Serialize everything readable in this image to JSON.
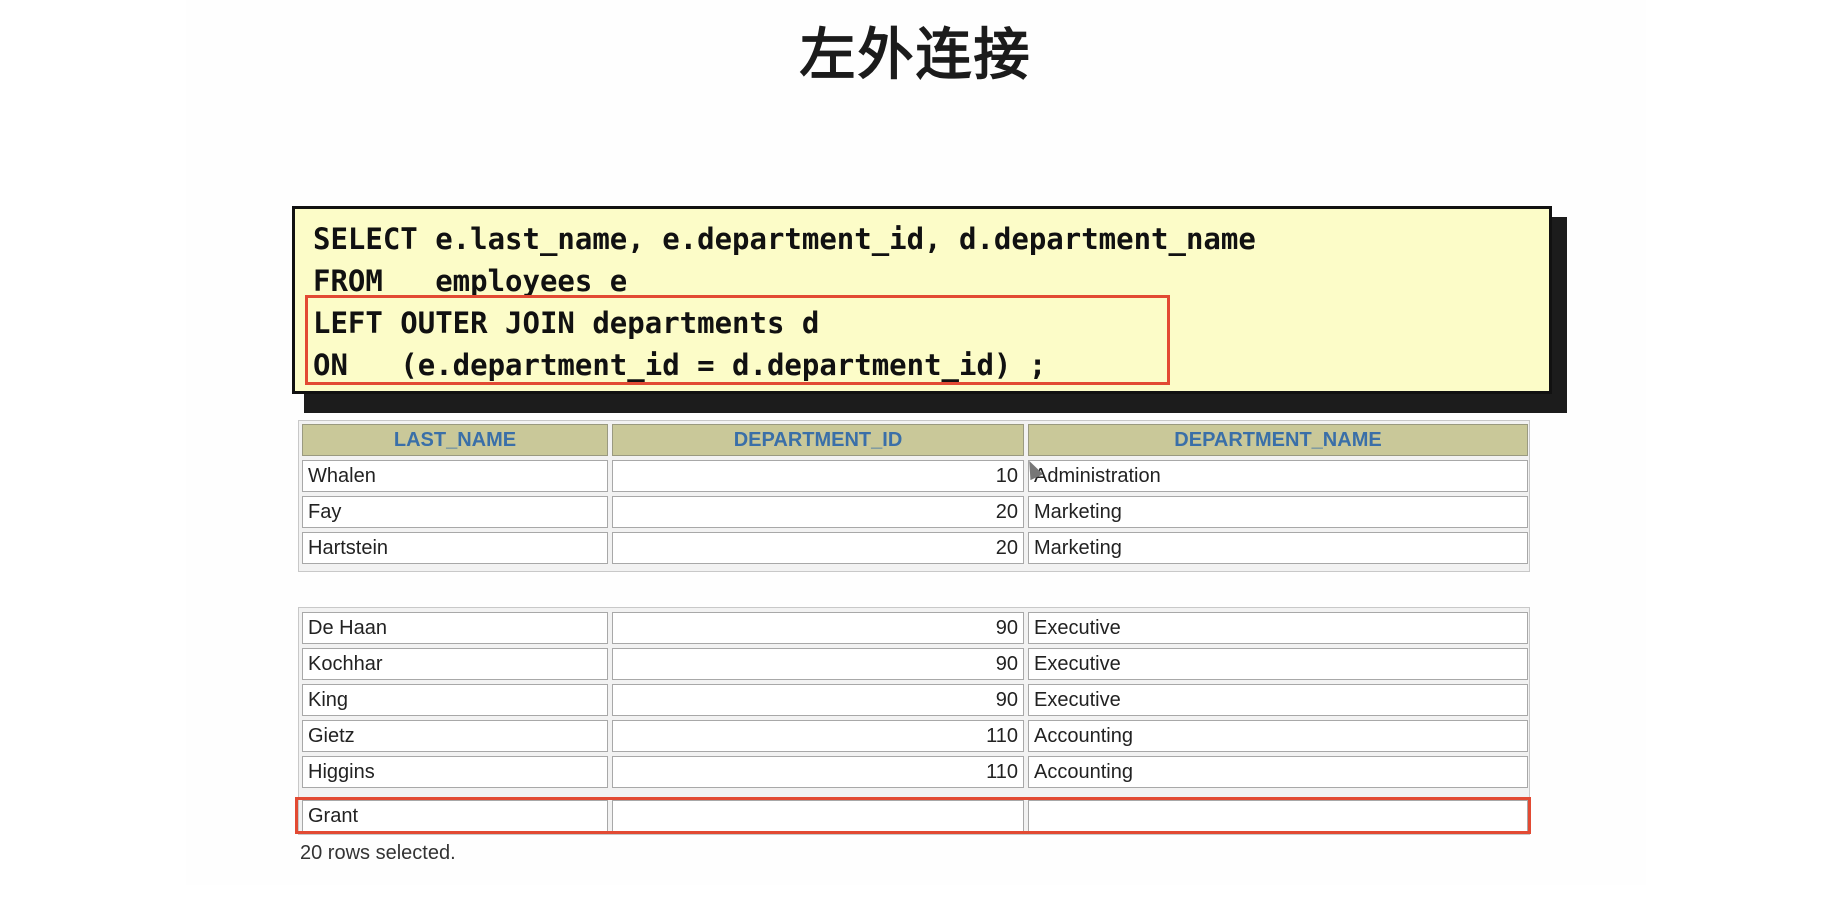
{
  "title": "左外连接",
  "sql": {
    "lines": [
      "SELECT e.last_name, e.department_id, d.department_name",
      "FROM   employees e",
      "LEFT OUTER JOIN departments d",
      "ON   (e.department_id = d.department_id) ;"
    ]
  },
  "table": {
    "headers": [
      "LAST_NAME",
      "DEPARTMENT_ID",
      "DEPARTMENT_NAME"
    ],
    "top_rows": [
      [
        "Whalen",
        "10",
        "Administration"
      ],
      [
        "Fay",
        "20",
        "Marketing"
      ],
      [
        "Hartstein",
        "20",
        "Marketing"
      ]
    ],
    "bottom_rows": [
      [
        "De Haan",
        "90",
        "Executive"
      ],
      [
        "Kochhar",
        "90",
        "Executive"
      ],
      [
        "King",
        "90",
        "Executive"
      ],
      [
        "Gietz",
        "110",
        "Accounting"
      ],
      [
        "Higgins",
        "110",
        "Accounting"
      ],
      [
        "Grant",
        "",
        ""
      ]
    ]
  },
  "footer": "20 rows selected.",
  "colors": {
    "code_background": "#fcfcc8",
    "header_background": "#c9c899",
    "header_text": "#3a6fa8",
    "highlight": "#e24a33"
  }
}
